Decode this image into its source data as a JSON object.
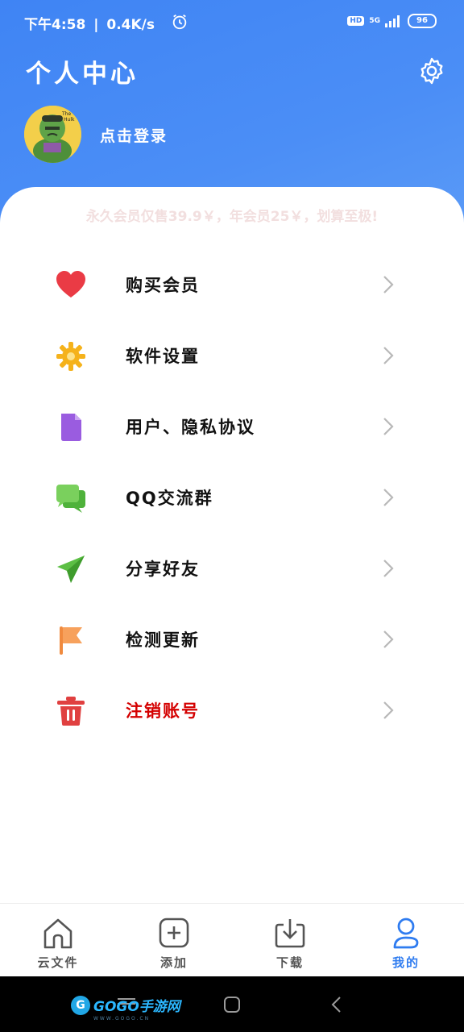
{
  "status_bar": {
    "time": "下午4:58",
    "speed": "0.4K/s",
    "hd": "HD",
    "network": "5G",
    "battery": "96"
  },
  "header": {
    "title": "个人中心",
    "login_text": "点击登录",
    "settings_icon": "gear-icon",
    "avatar_icon": "hulk-avatar"
  },
  "promo_text": "永久会员仅售39.9￥，年会员25￥，划算至极!",
  "menu": {
    "items": [
      {
        "label": "购买会员",
        "icon": "heart-icon"
      },
      {
        "label": "软件设置",
        "icon": "sun-gear-icon"
      },
      {
        "label": "用户、隐私协议",
        "icon": "document-icon"
      },
      {
        "label": "QQ交流群",
        "icon": "chat-icon"
      },
      {
        "label": "分享好友",
        "icon": "send-icon"
      },
      {
        "label": "检测更新",
        "icon": "flag-icon"
      },
      {
        "label": "注销账号",
        "icon": "trash-icon"
      }
    ]
  },
  "tabbar": {
    "tabs": [
      {
        "label": "云文件",
        "icon": "home-icon"
      },
      {
        "label": "添加",
        "icon": "add-icon"
      },
      {
        "label": "下载",
        "icon": "download-icon"
      },
      {
        "label": "我的",
        "icon": "user-icon"
      }
    ],
    "active_index": 3
  },
  "watermark": {
    "brand": "GOGO手游网",
    "url": "WWW.GOGO.CN"
  },
  "colors": {
    "header_blue": "#3f84f4",
    "danger_red": "#d40000",
    "tab_active": "#2f7cf0",
    "promo_text": "#f2dfdf"
  }
}
